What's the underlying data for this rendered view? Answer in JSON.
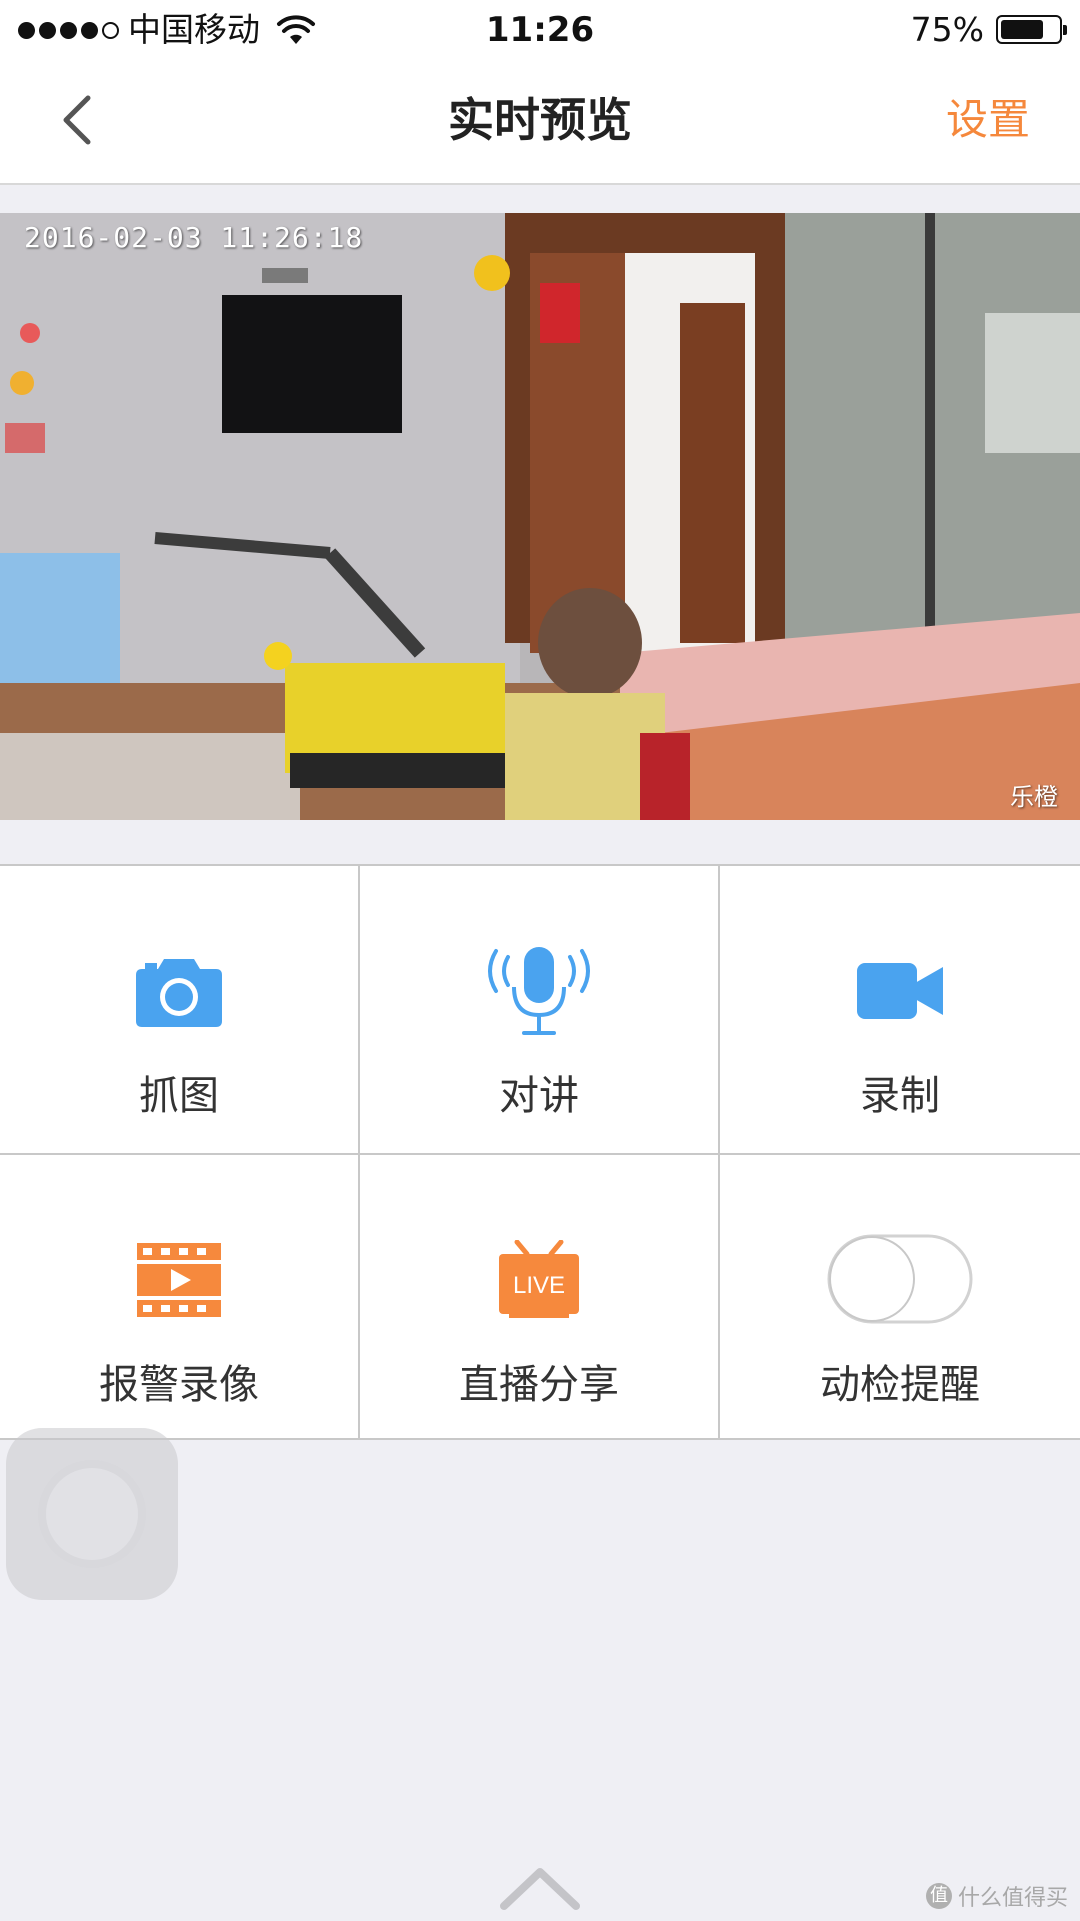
{
  "status_bar": {
    "carrier": "中国移动",
    "time": "11:26",
    "battery_percent": "75%",
    "battery_level": 0.75,
    "signal_bars_filled": 4,
    "signal_bars_total": 5
  },
  "nav": {
    "title": "实时预览",
    "settings_label": "设置",
    "back_icon": "chevron-left-icon"
  },
  "video": {
    "timestamp": "2016-02-03 11:26:18",
    "watermark": "乐橙"
  },
  "controls": [
    {
      "label": "抓图",
      "icon": "camera-icon"
    },
    {
      "label": "对讲",
      "icon": "microphone-icon"
    },
    {
      "label": "录制",
      "icon": "video-camera-icon"
    },
    {
      "label": "报警录像",
      "icon": "film-play-icon"
    },
    {
      "label": "直播分享",
      "icon": "live-tv-icon",
      "icon_text": "LIVE"
    },
    {
      "label": "动检提醒",
      "icon": "toggle-switch",
      "toggle_on": false
    }
  ],
  "colors": {
    "accent_orange": "#f5883c",
    "icon_blue": "#4aa3ef",
    "icon_orange": "#f6893d",
    "background": "#efeff4"
  },
  "site_watermark": "什么值得买"
}
